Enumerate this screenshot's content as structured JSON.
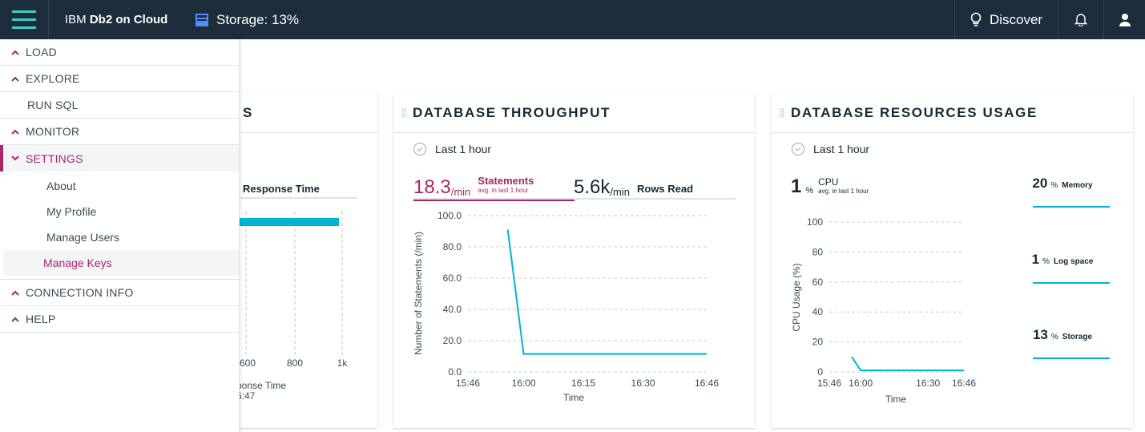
{
  "topbar": {
    "brand_prefix": "IBM ",
    "brand_bold": "Db2 on Cloud",
    "storage_label": "Storage: 13%",
    "discover_label": "Discover"
  },
  "colors": {
    "topbar": "#1d2d3b",
    "accent_teal": "#3bd0c3",
    "accent_magenta": "#a8266c",
    "line_cyan": "#00b4d0"
  },
  "sidebar": {
    "items": [
      {
        "label": "LOAD",
        "icon": "chevron-up-icon"
      },
      {
        "label": "EXPLORE",
        "icon": "chevron-up-icon"
      },
      {
        "label": "RUN SQL"
      },
      {
        "label": "MONITOR",
        "icon": "chevron-up-icon"
      },
      {
        "label": "SETTINGS",
        "icon": "chevron-down-icon",
        "expanded": true
      },
      {
        "label": "CONNECTION INFO",
        "icon": "chevron-up-icon"
      },
      {
        "label": "HELP",
        "icon": "chevron-up-icon"
      }
    ],
    "settings_sub": [
      "About",
      "My Profile",
      "Manage Users",
      "Manage Keys"
    ],
    "selected_sub": "Manage Keys"
  },
  "card1": {
    "title_partial": "S",
    "tab_label": "Response Time",
    "xticks": [
      "600",
      "800",
      "1k"
    ],
    "xlabel": "ponse Time",
    "subtext": "6:47"
  },
  "card2": {
    "title": "DATABASE THROUGHPUT",
    "time_range": "Last 1 hour",
    "statements_value": "18.3",
    "statements_unit": "/min",
    "statements_label": "Statements",
    "statements_sub": "avg. in last 1 hour",
    "rows_value": "5.6k",
    "rows_unit": "/min",
    "rows_label": "Rows Read",
    "chart_ylabel": "Number of Statements (/min)",
    "chart_xlabel": "Time"
  },
  "card3": {
    "title": "DATABASE RESOURCES USAGE",
    "time_range": "Last 1 hour",
    "cpu_value": "1",
    "cpu_unit": "%",
    "cpu_label": "CPU",
    "cpu_sub": "avg. in last 1 hour",
    "chart_ylabel": "CPU Usage (%)",
    "chart_xlabel": "Time",
    "memory": {
      "value": "20",
      "unit": "%",
      "label": "Memory"
    },
    "log": {
      "value": "1",
      "unit": "%",
      "label": "Log space"
    },
    "storage": {
      "value": "13",
      "unit": "%",
      "label": "Storage"
    }
  },
  "chart_data": [
    {
      "type": "line",
      "x": [
        "15:46",
        "15:56",
        "16:00",
        "16:15",
        "16:30",
        "16:46"
      ],
      "series": [
        {
          "values": [
            null,
            91,
            11.5,
            11.5,
            11.5,
            11.5
          ]
        }
      ],
      "xticks": [
        "15:46",
        "16:00",
        "16:15",
        "16:30",
        "16:46"
      ],
      "yticks": [
        "0.0",
        "20.0",
        "40.0",
        "60.0",
        "80.0",
        "100.0"
      ],
      "xlabel": "Time",
      "ylabel": "Number of Statements (/min)",
      "ylim": [
        0,
        100
      ],
      "grid": true
    },
    {
      "type": "line",
      "x": [
        "15:46",
        "15:56",
        "16:00",
        "16:30",
        "16:46"
      ],
      "series": [
        {
          "values": [
            null,
            10,
            1,
            1,
            1
          ]
        }
      ],
      "xticks": [
        "15:46",
        "16:00",
        "16:30",
        "16:46"
      ],
      "yticks": [
        "0",
        "20",
        "40",
        "60",
        "80",
        "100"
      ],
      "xlabel": "Time",
      "ylabel": "CPU Usage (%)",
      "ylim": [
        0,
        100
      ],
      "grid": true
    },
    {
      "type": "bar",
      "series": [
        {
          "values": [
            1000
          ]
        }
      ],
      "xticks": [
        "600",
        "800",
        "1k"
      ],
      "xlabel": "ponse Time",
      "grid": true
    }
  ]
}
